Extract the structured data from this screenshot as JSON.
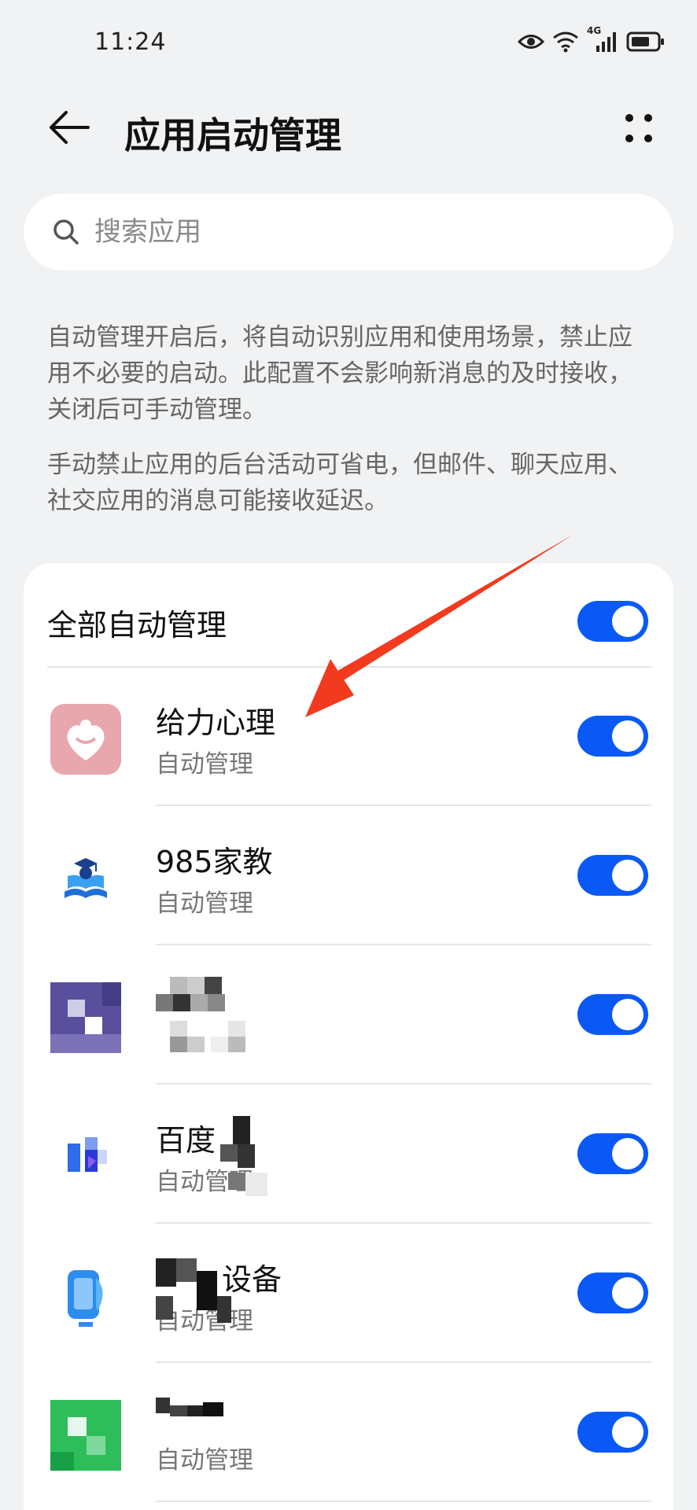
{
  "status_bar": {
    "time": "11:24",
    "network_label": "4G"
  },
  "app_bar": {
    "title": "应用启动管理"
  },
  "search": {
    "placeholder": "搜索应用"
  },
  "description": {
    "paragraph1": "自动管理开启后，将自动识别应用和使用场景，禁止应用不必要的启动。此配置不会影响新消息的及时接收，关闭后可手动管理。",
    "paragraph2": "手动禁止应用的后台活动可省电，但邮件、聊天应用、社交应用的消息可能接收延迟。"
  },
  "all_auto": {
    "label": "全部自动管理",
    "enabled": true
  },
  "apps": [
    {
      "name": "给力心理",
      "status": "自动管理",
      "enabled": true,
      "icon": "heart-icon"
    },
    {
      "name": "985家教",
      "status": "自动管理",
      "enabled": true,
      "icon": "graduation-book-icon"
    },
    {
      "name": "",
      "status": "",
      "enabled": true,
      "icon": "pixelated-icon"
    },
    {
      "name": "百度",
      "status": "自动管理",
      "enabled": true,
      "icon": "baidu-icon"
    },
    {
      "name": "设备",
      "status": "自动管理",
      "enabled": true,
      "icon": "phone-device-icon"
    },
    {
      "name": "",
      "status": "自动管理",
      "enabled": true,
      "icon": "green-app-icon"
    }
  ],
  "colors": {
    "accent": "#0a59f7",
    "background": "#f1f2f4",
    "annotation_arrow": "#f23a1e"
  }
}
